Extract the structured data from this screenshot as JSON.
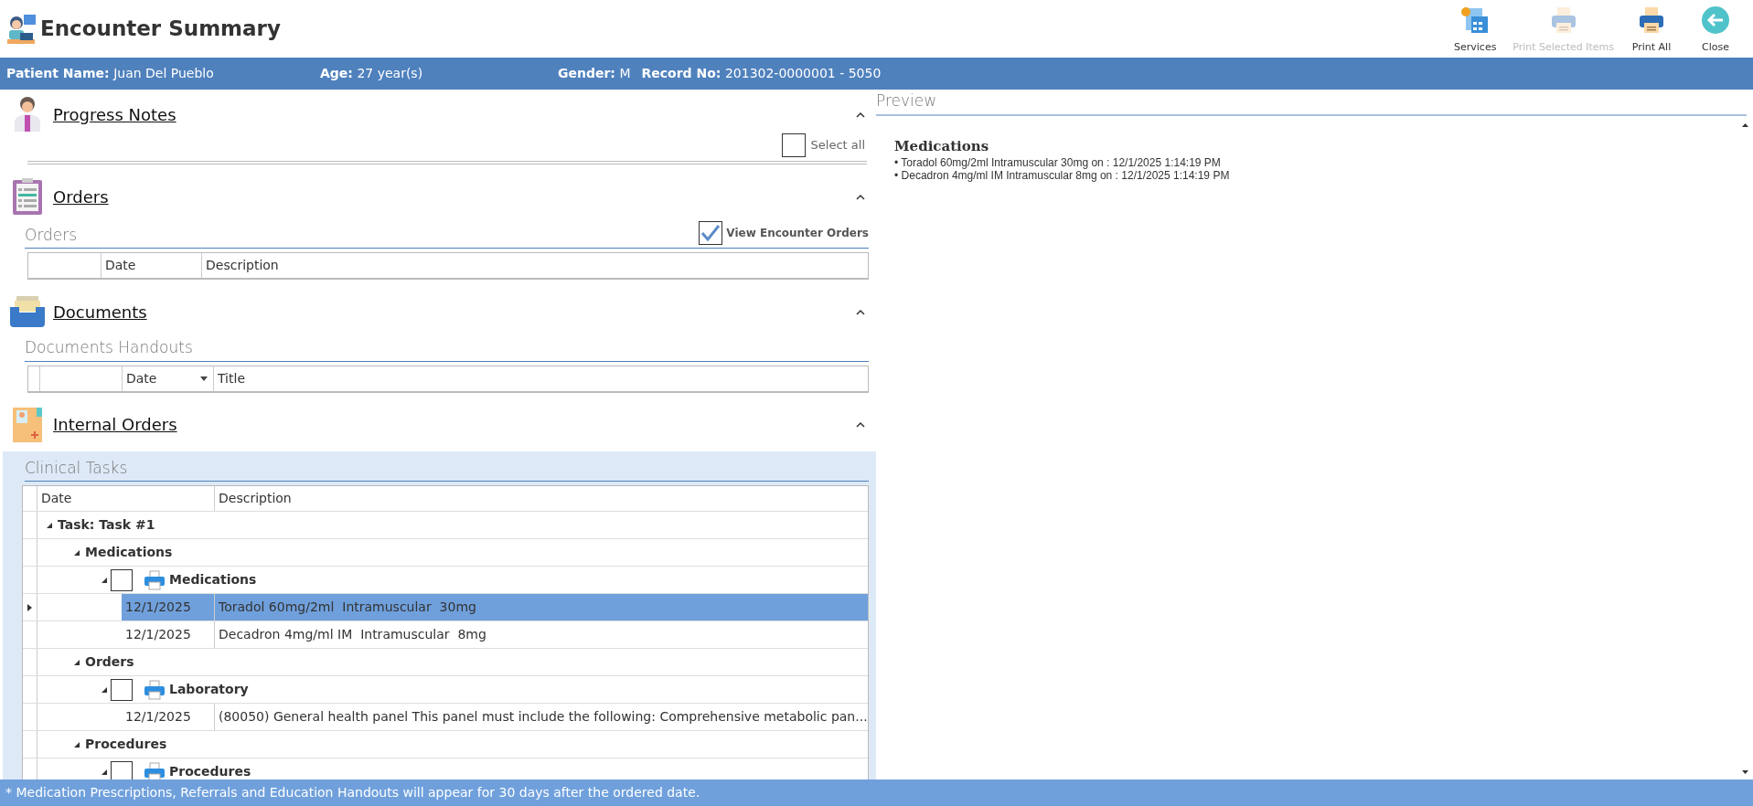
{
  "window": {
    "title": "Encounter Summary"
  },
  "toolbar": [
    {
      "kind": "services",
      "label": "Services",
      "disabled": false
    },
    {
      "kind": "print",
      "label": "Print Selected Items",
      "disabled": true
    },
    {
      "kind": "print",
      "label": "Print All",
      "disabled": false
    },
    {
      "kind": "close",
      "label": "Close",
      "disabled": false
    }
  ],
  "patient_bar": [
    {
      "label": "Patient Name:",
      "value": "Juan Del Pueblo"
    },
    {
      "label": "Age:",
      "value": "27 year(s)"
    },
    {
      "label": "Gender:",
      "value": "M"
    },
    {
      "label": "Record No:",
      "value": "201302-0000001 - 5050"
    }
  ],
  "sections": [
    {
      "kind": "notes",
      "title": "Progress Notes",
      "expanded": true,
      "select_all": {
        "label": "Select all",
        "checked": false
      }
    },
    {
      "kind": "orders",
      "title": "Orders",
      "expanded": true,
      "subtitle": "Orders",
      "toggle": {
        "label": "View Encounter Orders",
        "checked": true
      },
      "columns": [
        {
          "label": "Date",
          "sortable": false
        },
        {
          "label": "Description",
          "sortable": false
        }
      ]
    },
    {
      "kind": "documents",
      "title": "Documents",
      "expanded": true,
      "subtitle": "Documents Handouts",
      "columns": [
        {
          "label": "Date",
          "sortable": true
        },
        {
          "label": "Title",
          "sortable": false
        }
      ]
    },
    {
      "kind": "internal",
      "title": "Internal Orders",
      "expanded": true,
      "subtitle": "Clinical Tasks",
      "columns": [
        {
          "label": "Date",
          "sortable": false
        },
        {
          "label": "Description",
          "sortable": false
        }
      ],
      "tree": [
        {
          "kind": "group",
          "label": "Task: Task #1",
          "expanded": true,
          "children": [
            {
              "kind": "group",
              "label": "Medications",
              "expanded": true,
              "children": [
                {
                  "kind": "print_group",
                  "label": "Medications",
                  "expanded": true,
                  "checked": false,
                  "children": [
                    {
                      "kind": "item",
                      "date": "12/1/2025",
                      "description": "Toradol 60mg/2ml  Intramuscular  30mg",
                      "selected": true
                    },
                    {
                      "kind": "item",
                      "date": "12/1/2025",
                      "description": "Decadron 4mg/ml IM  Intramuscular  8mg",
                      "selected": false
                    }
                  ]
                }
              ]
            },
            {
              "kind": "group",
              "label": "Orders",
              "expanded": true,
              "children": [
                {
                  "kind": "print_group",
                  "label": "Laboratory",
                  "expanded": true,
                  "checked": false,
                  "children": [
                    {
                      "kind": "item",
                      "date": "12/1/2025",
                      "description": "(80050) General health panel This panel must include the following: Comprehensive metabolic pan...",
                      "selected": false
                    }
                  ]
                }
              ]
            },
            {
              "kind": "group",
              "label": "Procedures",
              "expanded": true,
              "children": [
                {
                  "kind": "print_group",
                  "label": "Procedures",
                  "expanded": true,
                  "checked": false
                }
              ]
            }
          ]
        }
      ]
    }
  ],
  "preview": {
    "title": "Preview",
    "heading": "Medications",
    "lines": [
      "• Toradol 60mg/2ml Intramuscular 30mg on : 12/1/2025 1:14:19 PM",
      "• Decadron 4mg/ml IM Intramuscular 8mg on : 12/1/2025 1:14:19 PM"
    ]
  },
  "footer": {
    "note": "* Medication Prescriptions, Referrals and Education Handouts will appear for 30 days after the ordered date."
  }
}
